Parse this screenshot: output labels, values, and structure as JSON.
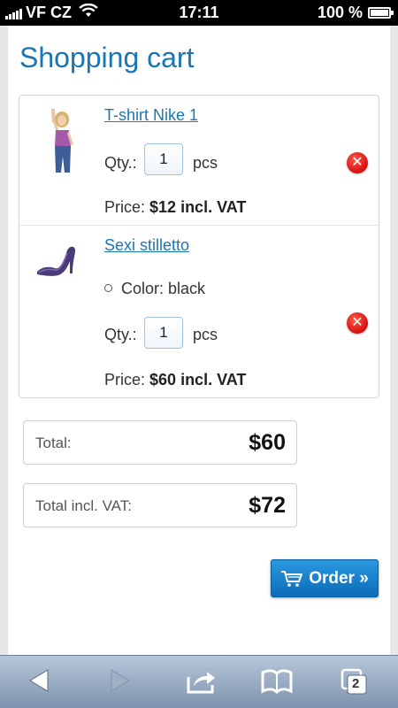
{
  "status_bar": {
    "carrier": "VF CZ",
    "time": "17:11",
    "battery": "100 %"
  },
  "page": {
    "title": "Shopping cart"
  },
  "cart": {
    "items": [
      {
        "name": "T-shirt Nike 1",
        "qty_label": "Qty.:",
        "qty_value": "1",
        "unit": "pcs",
        "price_label": "Price:",
        "price_value": "$12 incl. VAT"
      },
      {
        "name": "Sexi stilletto",
        "option": "Color: black",
        "qty_label": "Qty.:",
        "qty_value": "1",
        "unit": "pcs",
        "price_label": "Price:",
        "price_value": "$60 incl. VAT"
      }
    ]
  },
  "totals": {
    "total_label": "Total:",
    "total_value": "$60",
    "total_vat_label": "Total incl. VAT:",
    "total_vat_value": "$72"
  },
  "order_button": {
    "label": "Order »"
  },
  "toolbar": {
    "tabs_count": "2"
  },
  "colors": {
    "accent": "#1876b3",
    "link": "#1a77b4",
    "remove": "#d40f0f",
    "button": "#0b6bb8"
  }
}
